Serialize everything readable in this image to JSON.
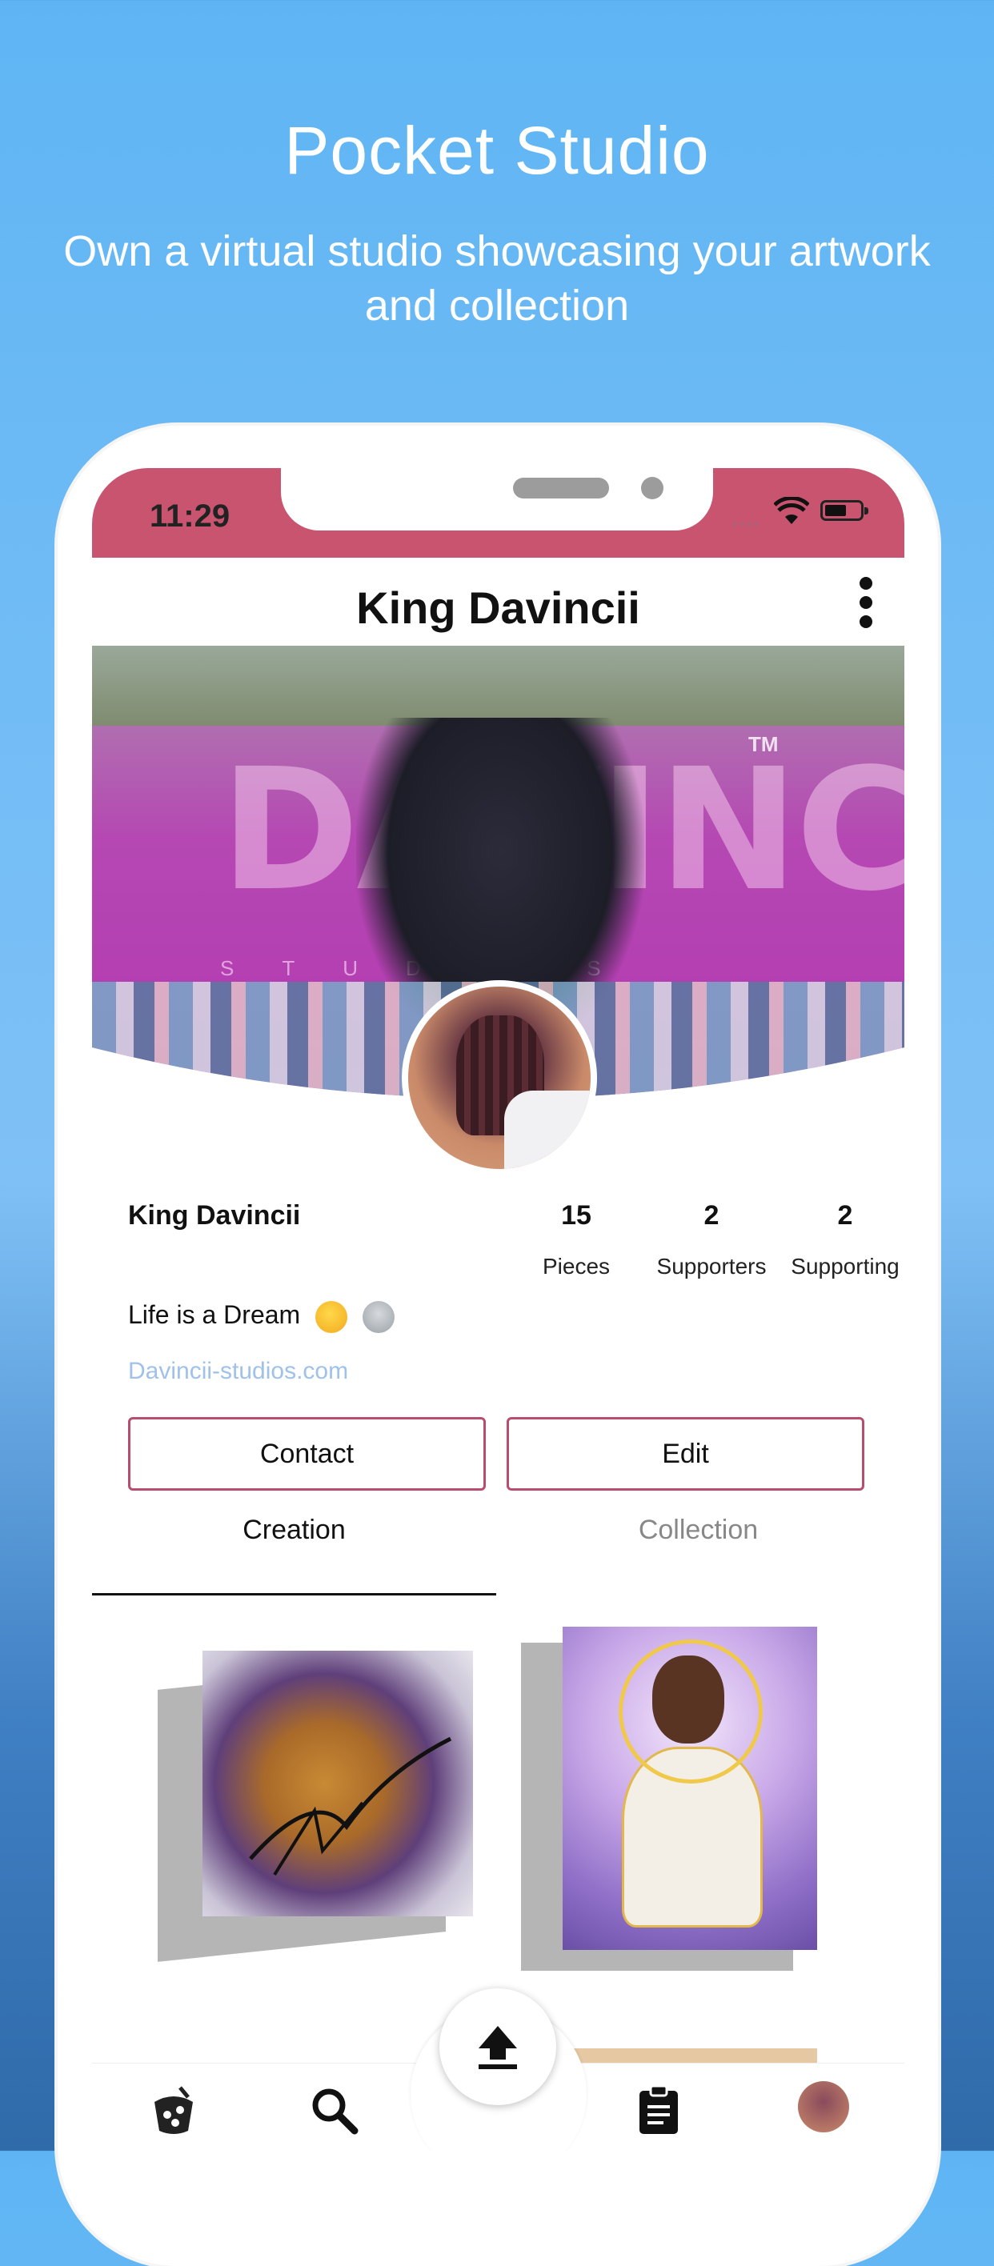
{
  "promo": {
    "title": "Pocket Studio",
    "subtitle": "Own a virtual studio showcasing your artwork and collection"
  },
  "status_bar": {
    "time": "11:29"
  },
  "header": {
    "title": "King Davincii",
    "menu_icon": "more-vertical-icon"
  },
  "cover": {
    "watermark": "DAVINCII",
    "watermark_tm": "TM",
    "watermark_sub": "STUDIOS"
  },
  "profile": {
    "name": "King Davincii",
    "stats": [
      {
        "value": "15",
        "label": "Pieces"
      },
      {
        "value": "2",
        "label": "Supporters"
      },
      {
        "value": "2",
        "label": "Supporting"
      }
    ],
    "bio": "Life is a Dream",
    "bio_emojis": [
      "sleeping-face-emoji",
      "alien-emoji"
    ],
    "link": "Davincii-studios.com"
  },
  "buttons": {
    "contact": "Contact",
    "edit": "Edit"
  },
  "tabs": [
    {
      "label": "Creation",
      "active": true
    },
    {
      "label": "Collection",
      "active": false
    }
  ],
  "artworks": [
    {
      "name": "basketball-abstract-painting"
    },
    {
      "name": "portrait-painting"
    }
  ],
  "bottom_nav": [
    {
      "icon": "palette-icon"
    },
    {
      "icon": "search-icon"
    },
    {
      "icon": "upload-icon"
    },
    {
      "icon": "clipboard-icon"
    },
    {
      "icon": "profile-avatar"
    }
  ],
  "colors": {
    "accent": "#c85470",
    "button_border": "#b84d6e",
    "link": "#9fc1ea"
  }
}
